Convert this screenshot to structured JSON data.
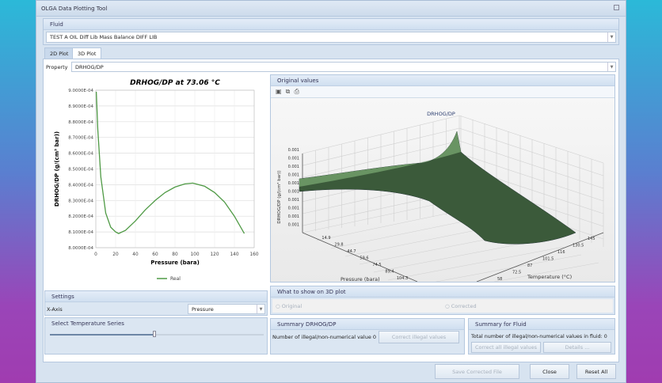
{
  "window": {
    "title": "OLGA Data Plotting Tool",
    "close_icon": "close-icon"
  },
  "fluid": {
    "header": "Fluid",
    "value": "TEST A OIL Diff Lib Mass Balance DIFF LIB"
  },
  "tabs": [
    {
      "label": "2D Plot",
      "active": false
    },
    {
      "label": "3D Plot",
      "active": true
    }
  ],
  "property": {
    "label": "Property",
    "value": "DRHOG/DP"
  },
  "chart_data": {
    "type": "line",
    "title": "DRHOG/DP at 73.06 °C",
    "xlabel": "Pressure (bara)",
    "ylabel": "DRHOG/DP (g/(cm³ bar))",
    "xlim": [
      0,
      160
    ],
    "ylim": [
      0.0008,
      0.0009
    ],
    "xticks": [
      "0",
      "20",
      "40",
      "60",
      "80",
      "100",
      "120",
      "140",
      "160"
    ],
    "yticks": [
      "8.0000E-04",
      "8.1000E-04",
      "8.2000E-04",
      "8.3000E-04",
      "8.4000E-04",
      "8.5000E-04",
      "8.6000E-04",
      "8.7000E-04",
      "8.8000E-04",
      "8.9000E-04",
      "9.0000E-04"
    ],
    "grid": true,
    "legend": "bottom",
    "series": [
      {
        "name": "Real",
        "color": "#4f9a45",
        "x": [
          0.5,
          2,
          5,
          10,
          15,
          20,
          23,
          30,
          40,
          50,
          60,
          70,
          80,
          90,
          98,
          110,
          120,
          130,
          140,
          150
        ],
        "y": [
          0.000899,
          0.000875,
          0.000845,
          0.000822,
          0.000813,
          0.00081,
          0.000809,
          0.000811,
          0.000817,
          0.000824,
          0.00083,
          0.000835,
          0.0008385,
          0.0008405,
          0.000841,
          0.000839,
          0.000835,
          0.000829,
          0.00082,
          0.000809
        ]
      }
    ]
  },
  "plot3d": {
    "header": "Original values",
    "toolbar": [
      "save-icon",
      "copy-icon",
      "print-icon"
    ],
    "title": "DRHOG/DP",
    "zlabel": "DRHOG/DP (g/(cm³ bar))",
    "zticks": [
      "0.001",
      "0.001",
      "0.001",
      "0.001",
      "0.001",
      "0.001",
      "0.001",
      "0.001",
      "0.001",
      "0.001"
    ],
    "xlabel": "Pressure (bara)",
    "xticks": [
      "14.9",
      "29.8",
      "44.7",
      "59.6",
      "74.5",
      "89.4",
      "104.3"
    ],
    "ylabel": "Temperature (°C)",
    "yticks": [
      "58",
      "72.5",
      "87",
      "101.5",
      "116",
      "130.5",
      "145"
    ]
  },
  "settings": {
    "header": "Settings",
    "xaxis_label": "X-Axis",
    "xaxis_value": "Pressure"
  },
  "temperature_series": {
    "header": "Select Temperature Series",
    "slider_fraction": 0.49
  },
  "show3d": {
    "header": "What to show on 3D plot",
    "original": "Original",
    "corrected": "Corrected"
  },
  "summary_prop": {
    "header": "Summary DRHOG/DP",
    "text": "Number of illegal/non-numerical value 0",
    "button": "Correct illegal values"
  },
  "summary_fluid": {
    "header": "Summary for Fluid",
    "text": "Total number of illegal/non-numerical values in fluid: 0",
    "correct_all": "Correct all illegal values",
    "details": "Details ..."
  },
  "buttons": {
    "save": "Save Corrected File",
    "close": "Close",
    "reset": "Reset All"
  }
}
